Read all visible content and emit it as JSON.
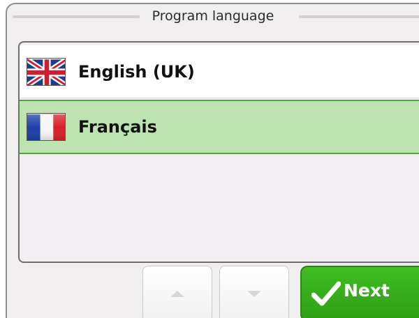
{
  "dialog": {
    "title": "Program language"
  },
  "languages": {
    "items": [
      {
        "label": "English (UK)",
        "flag": "uk-flag-icon",
        "selected": false
      },
      {
        "label": "Français",
        "flag": "france-flag-icon",
        "selected": true
      }
    ]
  },
  "buttons": {
    "scroll_up": "up-arrow-icon",
    "scroll_down": "down-arrow-icon",
    "next_label": "Next"
  },
  "colors": {
    "panel_background": "#f1eeef",
    "selected_row": "#bde3b0",
    "selected_border": "#4ea53c",
    "next_button": "#3fbe22"
  }
}
